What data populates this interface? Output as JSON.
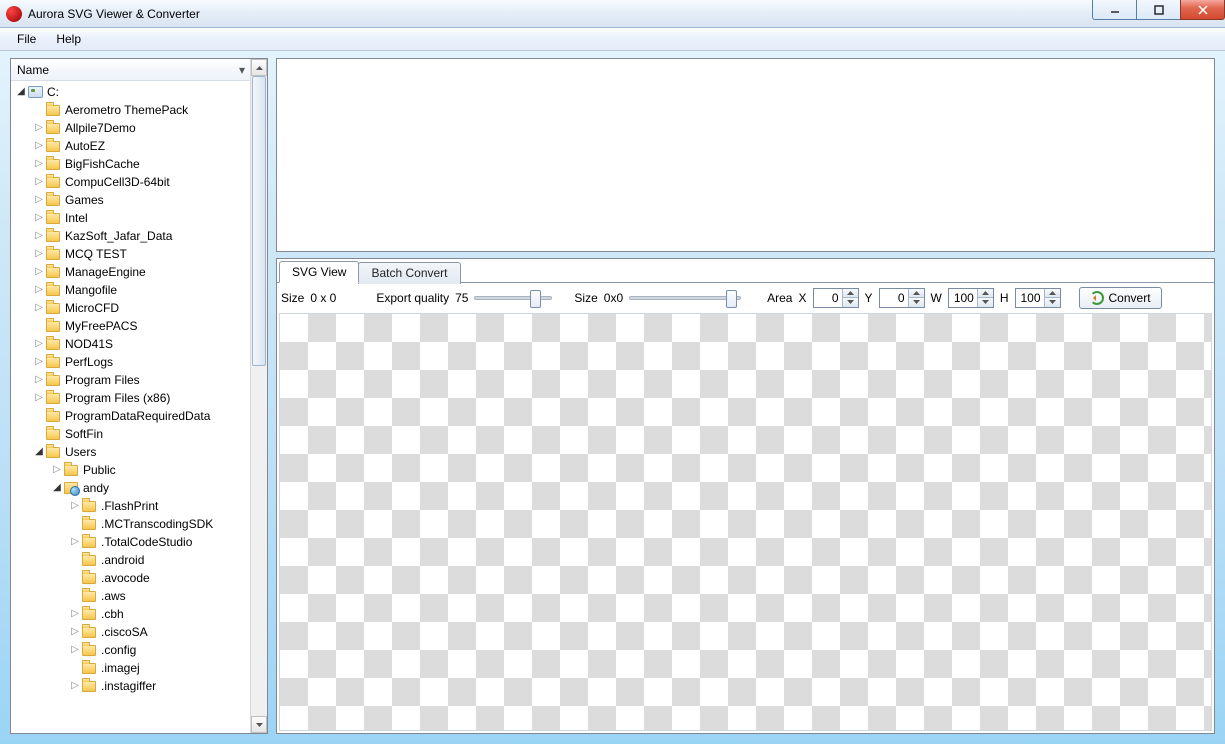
{
  "window": {
    "title": "Aurora SVG Viewer & Converter"
  },
  "menu": {
    "file": "File",
    "help": "Help"
  },
  "tree": {
    "header": "Name",
    "root": "C:",
    "items": [
      {
        "label": "Aerometro ThemePack",
        "expander": "none",
        "indent": 1,
        "kind": "folder"
      },
      {
        "label": "Allpile7Demo",
        "expander": "right",
        "indent": 1,
        "kind": "folder"
      },
      {
        "label": "AutoEZ",
        "expander": "right",
        "indent": 1,
        "kind": "folder"
      },
      {
        "label": "BigFishCache",
        "expander": "right",
        "indent": 1,
        "kind": "folder"
      },
      {
        "label": "CompuCell3D-64bit",
        "expander": "right",
        "indent": 1,
        "kind": "folder"
      },
      {
        "label": "Games",
        "expander": "right",
        "indent": 1,
        "kind": "folder"
      },
      {
        "label": "Intel",
        "expander": "right",
        "indent": 1,
        "kind": "folder"
      },
      {
        "label": "KazSoft_Jafar_Data",
        "expander": "right",
        "indent": 1,
        "kind": "folder"
      },
      {
        "label": "MCQ TEST",
        "expander": "right",
        "indent": 1,
        "kind": "folder"
      },
      {
        "label": "ManageEngine",
        "expander": "right",
        "indent": 1,
        "kind": "folder"
      },
      {
        "label": "Mangofile",
        "expander": "right",
        "indent": 1,
        "kind": "folder"
      },
      {
        "label": "MicroCFD",
        "expander": "right",
        "indent": 1,
        "kind": "folder"
      },
      {
        "label": "MyFreePACS",
        "expander": "none",
        "indent": 1,
        "kind": "folder"
      },
      {
        "label": "NOD41S",
        "expander": "right",
        "indent": 1,
        "kind": "folder"
      },
      {
        "label": "PerfLogs",
        "expander": "right",
        "indent": 1,
        "kind": "folder"
      },
      {
        "label": "Program Files",
        "expander": "right",
        "indent": 1,
        "kind": "folder"
      },
      {
        "label": "Program Files (x86)",
        "expander": "right",
        "indent": 1,
        "kind": "folder"
      },
      {
        "label": "ProgramDataRequiredData",
        "expander": "none",
        "indent": 1,
        "kind": "folder"
      },
      {
        "label": "SoftFin",
        "expander": "none",
        "indent": 1,
        "kind": "folder"
      },
      {
        "label": "Users",
        "expander": "down",
        "indent": 1,
        "kind": "folder"
      },
      {
        "label": "Public",
        "expander": "right",
        "indent": 2,
        "kind": "folder"
      },
      {
        "label": "andy",
        "expander": "down",
        "indent": 2,
        "kind": "user"
      },
      {
        "label": ".FlashPrint",
        "expander": "right",
        "indent": 3,
        "kind": "folder"
      },
      {
        "label": ".MCTranscodingSDK",
        "expander": "none",
        "indent": 3,
        "kind": "folder"
      },
      {
        "label": ".TotalCodeStudio",
        "expander": "right",
        "indent": 3,
        "kind": "folder"
      },
      {
        "label": ".android",
        "expander": "none",
        "indent": 3,
        "kind": "folder"
      },
      {
        "label": ".avocode",
        "expander": "none",
        "indent": 3,
        "kind": "folder"
      },
      {
        "label": ".aws",
        "expander": "none",
        "indent": 3,
        "kind": "folder"
      },
      {
        "label": ".cbh",
        "expander": "right",
        "indent": 3,
        "kind": "folder"
      },
      {
        "label": ".ciscoSA",
        "expander": "right",
        "indent": 3,
        "kind": "folder"
      },
      {
        "label": ".config",
        "expander": "right",
        "indent": 3,
        "kind": "folder"
      },
      {
        "label": ".imagej",
        "expander": "none",
        "indent": 3,
        "kind": "folder"
      },
      {
        "label": ".instagiffer",
        "expander": "right",
        "indent": 3,
        "kind": "folder"
      }
    ]
  },
  "tabs": {
    "svg_view": "SVG View",
    "batch_convert": "Batch Convert"
  },
  "toolbar": {
    "size_label": "Size",
    "size_value": "0 x 0",
    "export_quality_label": "Export  quality",
    "export_quality_value": "75",
    "size2_label": "Size",
    "size2_value": "0x0",
    "area_label": "Area",
    "x_label": "X",
    "x_value": "0",
    "y_label": "Y",
    "y_value": "0",
    "w_label": "W",
    "w_value": "100",
    "h_label": "H",
    "h_value": "100",
    "convert_label": "Convert"
  }
}
